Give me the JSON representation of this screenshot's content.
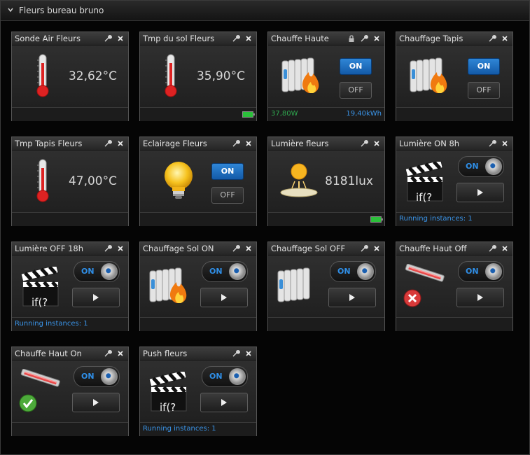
{
  "panel": {
    "title": "Fleurs bureau bruno"
  },
  "widgets": [
    {
      "title": "Sonde Air Fleurs",
      "value": "32,62°C"
    },
    {
      "title": "Tmp du sol Fleurs",
      "value": "35,90°C"
    },
    {
      "title": "Chauffe Haute",
      "on_label": "ON",
      "off_label": "OFF",
      "power": "37,80W",
      "energy": "19,40kWh"
    },
    {
      "title": "Chauffage Tapis",
      "on_label": "ON",
      "off_label": "OFF"
    },
    {
      "title": "Tmp Tapis Fleurs",
      "value": "47,00°C"
    },
    {
      "title": "Eclairage Fleurs",
      "on_label": "ON",
      "off_label": "OFF"
    },
    {
      "title": "Lumière fleurs",
      "value": "8181lux"
    },
    {
      "title": "Lumière ON 8h",
      "toggle": "ON",
      "running": "Running instances: 1"
    },
    {
      "title": "Lumière OFF 18h",
      "toggle": "ON",
      "running": "Running instances: 1"
    },
    {
      "title": "Chauffage Sol ON",
      "toggle": "ON"
    },
    {
      "title": "Chauffage Sol OFF",
      "toggle": "ON"
    },
    {
      "title": "Chauffe Haut Off",
      "toggle": "ON"
    },
    {
      "title": "Chauffe Haut On",
      "toggle": "ON"
    },
    {
      "title": "Push fleurs",
      "toggle": "ON",
      "running": "Running instances: 1"
    }
  ],
  "scene_label": "if(?"
}
